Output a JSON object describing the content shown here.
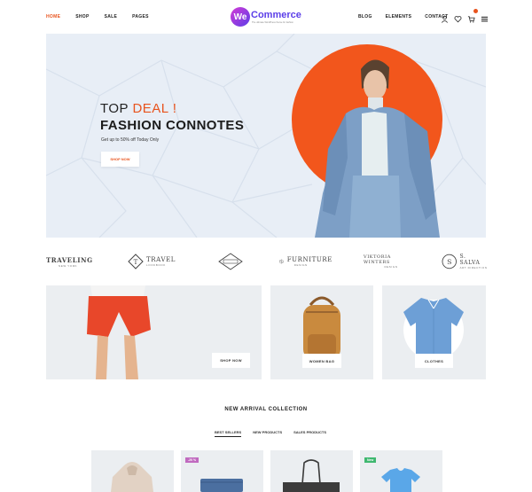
{
  "nav": {
    "left": [
      "HOME",
      "SHOP",
      "SALE",
      "PAGES"
    ],
    "right": [
      "BLOG",
      "ELEMENTS",
      "CONTACT"
    ]
  },
  "logo": {
    "mark": "We",
    "name": "Commerce",
    "tagline": "The ultimate WordPress theme for fashion"
  },
  "icons": [
    "user-icon",
    "heart-icon",
    "cart-icon",
    "menu-icon"
  ],
  "hero": {
    "title_prefix": "TOP ",
    "title_accent": "DEAL !",
    "title_main": "FASHION CONNOTES",
    "subtitle": "Get up to 50% off Today Only",
    "button": "SHOP NOW",
    "accent_color": "#f2561c"
  },
  "brands": [
    {
      "name": "TRAVELING",
      "sub": "NEW YORK"
    },
    {
      "name": "TRAVEL",
      "sub": "LOOKBOOK"
    },
    {
      "name": "",
      "sub": ""
    },
    {
      "name": "FURNITURE",
      "sub": "DESIGN"
    },
    {
      "name": "VIKTORIA WINTERS",
      "sub": "DESIGN"
    },
    {
      "name": "S. SALVA",
      "sub": "ART DIRECTION"
    }
  ],
  "categories": {
    "shorts_button": "SHOP NOW",
    "women_bag": "WOMEN BAG",
    "clothes": "CLOTHES"
  },
  "new_arrival": {
    "title": "NEW ARRIVAL COLLECTION",
    "tabs": [
      "BEST SELLERS",
      "NEW PRODUCTS",
      "SALES PRODUCTS"
    ],
    "badges": {
      "sale": "-20 %",
      "new": "New"
    }
  }
}
